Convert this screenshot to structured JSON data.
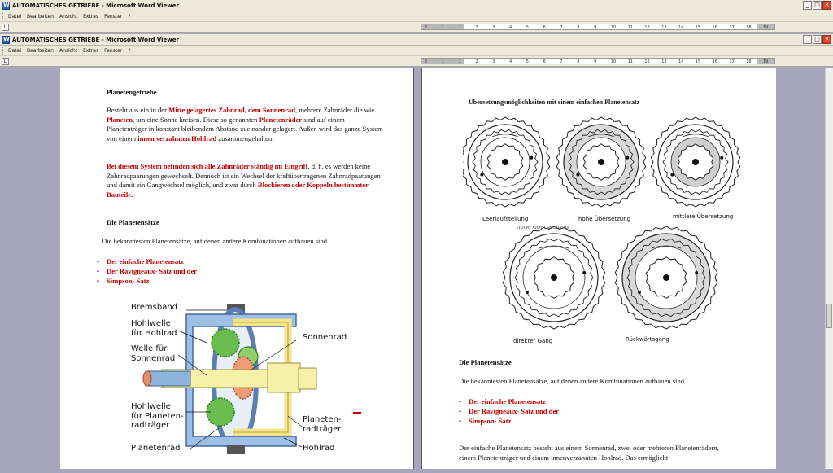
{
  "window_back": {
    "title": "AUTOMATISCHES  GETRIEBE - Microsoft Word Viewer"
  },
  "window_front": {
    "title": "AUTOMATISCHES  GETRIEBE - Microsoft Word Viewer"
  },
  "window_controls": {
    "minimize": "_",
    "maximize": "□",
    "close": "✕"
  },
  "menu": [
    "Datei",
    "Bearbeiten",
    "Ansicht",
    "Extras",
    "Fenster",
    "?"
  ],
  "ruler": {
    "tab_selector": "L",
    "ticks": [
      "2",
      "1",
      "1",
      "2",
      "3",
      "4",
      "5",
      "6",
      "7",
      "8",
      "9",
      "10",
      "11",
      "12",
      "13",
      "14",
      "15",
      "16",
      "17",
      "18",
      "19"
    ]
  },
  "left_page": {
    "heading1": "Planetengetriebe",
    "para1": {
      "t1": "Besteht aus ein in der ",
      "r1": "Mitte gelagertes Zahnrad, dem Sonnenrad",
      "t2": ", mehrere Zahnräder die wie ",
      "r2": "Planeten",
      "t3": ", um eine Sonne kreisen.       Diese so genannten ",
      "r3": "Planetenräder",
      "t4": " sind auf einem Planetenträger in konstant bleibendem Abstand zueinander gelagert. Außen wird das ganze System von einem ",
      "r4": "innen verzahnten Hohlrad",
      "t5": " zusammengehalten."
    },
    "para2": {
      "r1": "Bei diesem System befinden sich alle Zahnräder ständig im Eingriff",
      "t1": ", d. h. es werden keine Zahnradpaarungen gewechselt. Dennoch ist ein Wechsel der kraftübertragenen Zahnradpaarungen und damit ein Gangwechsel möglich, und zwar durch ",
      "r2": "Blockieren oder Koppeln bestimmter Bauteile."
    },
    "heading2": "Die Planetensätze",
    "intro": "Die bekanntesten Planetensätze, auf denen andere Kombinationen aufbauen sind",
    "bullets": [
      "Der einfache Planetensatz",
      "Der Ravigneaux- Satz und der",
      "Simpson- Satz"
    ],
    "diagram_labels": {
      "bremsband": "Bremsband",
      "hohlwelle_hohlrad": [
        "Hohlwelle",
        "für Hohlrad"
      ],
      "welle_sonnenrad": [
        "Welle für",
        "Sonnenrad"
      ],
      "sonnenrad": "Sonnenrad",
      "hohlwelle_traeger": [
        "Hohlwelle",
        "für Planeten-",
        "radträger"
      ],
      "planetenradtraeger": [
        "Planeten-",
        "radträger"
      ],
      "planetenrad": "Planetenrad",
      "hohlrad": "Hohlrad"
    }
  },
  "right_page": {
    "heading1": "Übersetzungsmöglichkeiten mit einem einfachen Planetensatz",
    "gear_captions": [
      "Leerlaufstellung",
      "hohe Übersetzung",
      "mittlere Übersetzung",
      "direkter Gang",
      "Rückwärtsgang"
    ],
    "cut_caption": "hohe Übersetzung",
    "heading2": "Die Planetensätze",
    "intro": "Die bekanntesten Planetensätze, auf denen andere Kombinationen aufbauen sind",
    "bullets": [
      "Der einfache Planetensatz",
      "Der Ravigneaux- Satz und der",
      "Simpson- Satz"
    ],
    "para": "Der einfache Planetensatz besteht aus einem Sonnenrad, zwei oder mehreren Planetenrädern, einem Planetenträger und einem innenverzahnten Hohlrad. Das ermöglicht"
  },
  "colors": {
    "accent_red": "#c00000",
    "doc_bg": "#a7a6bd",
    "chrome": "#ece9d8"
  }
}
